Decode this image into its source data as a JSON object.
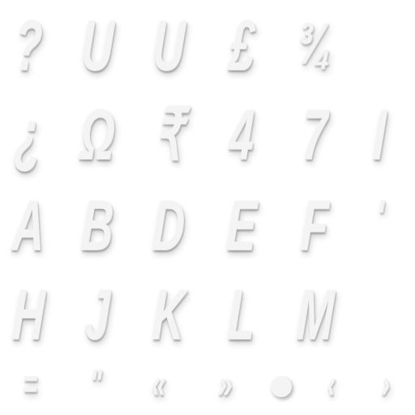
{
  "glyph_sheet": {
    "rows": [
      [
        "?",
        "U",
        "U",
        "£",
        "¾"
      ],
      [
        "¿",
        "Ω",
        "₹",
        "4",
        "7",
        "I"
      ],
      [
        "A",
        "B",
        "D",
        "E",
        "F",
        "'"
      ],
      [
        "H",
        "J",
        "K",
        "L",
        "M"
      ],
      [
        "=",
        "\"",
        "«",
        "»",
        "●",
        "‹",
        "›"
      ]
    ]
  },
  "colors": {
    "glyph_fill": "#f4f4f4",
    "background": "#ffffff"
  }
}
